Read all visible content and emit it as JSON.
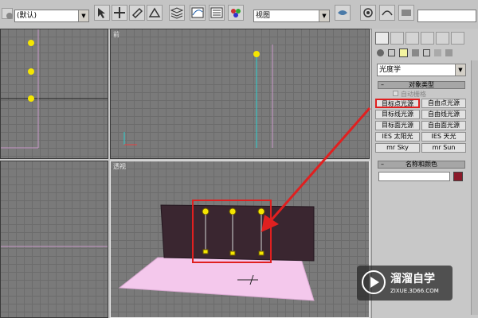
{
  "toolbar": {
    "selection_filter": "(默认)",
    "view_mode": "视图"
  },
  "viewports": {
    "top_left_label": "",
    "top_right_label": "前",
    "bottom_left_label": "",
    "bottom_right_label": "透视"
  },
  "command_panel": {
    "light_type_dropdown": "光度学",
    "object_type_rollout": "对象类型",
    "auto_grid_label": "自动栅格",
    "buttons": [
      "目标点光源",
      "自由点光源",
      "目标线光源",
      "自由线光源",
      "目标面光源",
      "自由面光源",
      "IES 太阳光",
      "IES 天光",
      "mr Sky",
      "mr Sun"
    ],
    "name_color_rollout": "名称和颜色",
    "name_value": "",
    "object_color": "#8b1a2a"
  },
  "watermark": {
    "brand": "溜溜自学",
    "url": "ZIXUE.3D66.COM"
  },
  "colors": {
    "highlight_red": "#e02020",
    "light_yellow": "#f5e600",
    "wall": "#3a2630",
    "floor": "#f4c8ec"
  }
}
